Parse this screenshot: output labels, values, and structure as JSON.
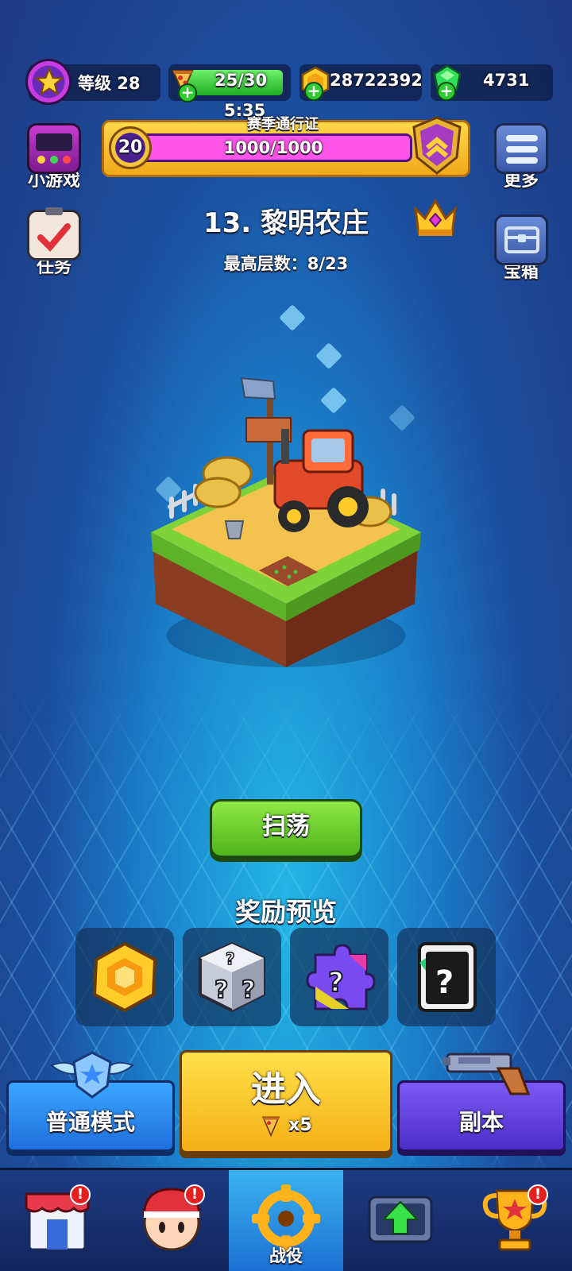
{
  "top_bar": {
    "level_label": "等级 28",
    "energy": "25/30",
    "coins": "28722392",
    "gems": "4731"
  },
  "season_pass": {
    "timer": "5:35",
    "title": "赛季通行证",
    "level": "20",
    "progress_text": "1000/1000",
    "progress": 1.0
  },
  "side_left": {
    "minigame_label": "小游戏",
    "quests_label": "任务"
  },
  "side_right": {
    "more_label": "更多",
    "chest_label": "宝箱"
  },
  "stage": {
    "title": "13. 黎明农庄",
    "max_floors": "最高层数：8/23"
  },
  "actions": {
    "sweep_label": "扫荡",
    "reward_preview_label": "奖励预览"
  },
  "rewards": [
    {
      "icon": "gold-hex-coin-icon"
    },
    {
      "icon": "mystery-dice-icon"
    },
    {
      "icon": "mystery-puzzle-icon"
    },
    {
      "icon": "mystery-card-icon"
    }
  ],
  "modes": {
    "normal_label": "普通模式",
    "enter_label": "进入",
    "enter_cost": "x5",
    "dungeon_label": "副本"
  },
  "nav": {
    "items": [
      {
        "id": "shop",
        "label": "",
        "alert": "!"
      },
      {
        "id": "hero",
        "label": "",
        "alert": "!"
      },
      {
        "id": "campaign",
        "label": "战役",
        "alert": ""
      },
      {
        "id": "upgrade",
        "label": "",
        "alert": ""
      },
      {
        "id": "trophy",
        "label": "",
        "alert": "!"
      }
    ]
  },
  "colors": {
    "background": "#1c4fa0",
    "accent_gold": "#f5b015",
    "accent_green": "#4fb51b",
    "accent_purple": "#b316c4"
  }
}
